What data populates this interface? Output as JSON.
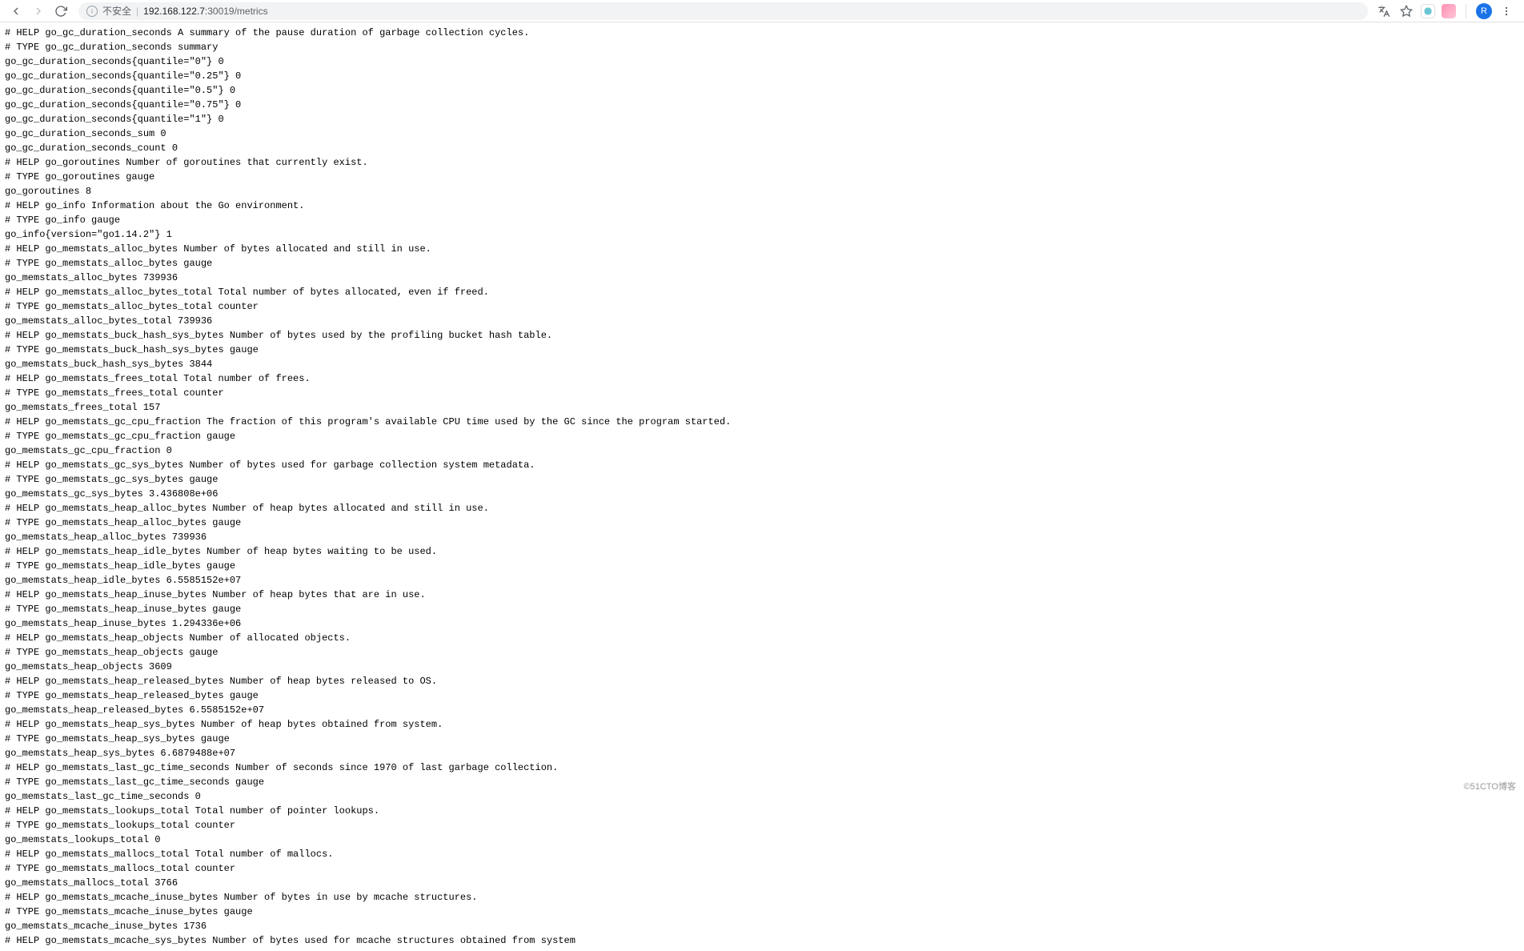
{
  "toolbar": {
    "insecure_label": "不安全",
    "url_host": "192.168.122.7",
    "url_port_path": ":30019/metrics",
    "avatar_initial": "R"
  },
  "metrics_text": "# HELP go_gc_duration_seconds A summary of the pause duration of garbage collection cycles.\n# TYPE go_gc_duration_seconds summary\ngo_gc_duration_seconds{quantile=\"0\"} 0\ngo_gc_duration_seconds{quantile=\"0.25\"} 0\ngo_gc_duration_seconds{quantile=\"0.5\"} 0\ngo_gc_duration_seconds{quantile=\"0.75\"} 0\ngo_gc_duration_seconds{quantile=\"1\"} 0\ngo_gc_duration_seconds_sum 0\ngo_gc_duration_seconds_count 0\n# HELP go_goroutines Number of goroutines that currently exist.\n# TYPE go_goroutines gauge\ngo_goroutines 8\n# HELP go_info Information about the Go environment.\n# TYPE go_info gauge\ngo_info{version=\"go1.14.2\"} 1\n# HELP go_memstats_alloc_bytes Number of bytes allocated and still in use.\n# TYPE go_memstats_alloc_bytes gauge\ngo_memstats_alloc_bytes 739936\n# HELP go_memstats_alloc_bytes_total Total number of bytes allocated, even if freed.\n# TYPE go_memstats_alloc_bytes_total counter\ngo_memstats_alloc_bytes_total 739936\n# HELP go_memstats_buck_hash_sys_bytes Number of bytes used by the profiling bucket hash table.\n# TYPE go_memstats_buck_hash_sys_bytes gauge\ngo_memstats_buck_hash_sys_bytes 3844\n# HELP go_memstats_frees_total Total number of frees.\n# TYPE go_memstats_frees_total counter\ngo_memstats_frees_total 157\n# HELP go_memstats_gc_cpu_fraction The fraction of this program's available CPU time used by the GC since the program started.\n# TYPE go_memstats_gc_cpu_fraction gauge\ngo_memstats_gc_cpu_fraction 0\n# HELP go_memstats_gc_sys_bytes Number of bytes used for garbage collection system metadata.\n# TYPE go_memstats_gc_sys_bytes gauge\ngo_memstats_gc_sys_bytes 3.436808e+06\n# HELP go_memstats_heap_alloc_bytes Number of heap bytes allocated and still in use.\n# TYPE go_memstats_heap_alloc_bytes gauge\ngo_memstats_heap_alloc_bytes 739936\n# HELP go_memstats_heap_idle_bytes Number of heap bytes waiting to be used.\n# TYPE go_memstats_heap_idle_bytes gauge\ngo_memstats_heap_idle_bytes 6.5585152e+07\n# HELP go_memstats_heap_inuse_bytes Number of heap bytes that are in use.\n# TYPE go_memstats_heap_inuse_bytes gauge\ngo_memstats_heap_inuse_bytes 1.294336e+06\n# HELP go_memstats_heap_objects Number of allocated objects.\n# TYPE go_memstats_heap_objects gauge\ngo_memstats_heap_objects 3609\n# HELP go_memstats_heap_released_bytes Number of heap bytes released to OS.\n# TYPE go_memstats_heap_released_bytes gauge\ngo_memstats_heap_released_bytes 6.5585152e+07\n# HELP go_memstats_heap_sys_bytes Number of heap bytes obtained from system.\n# TYPE go_memstats_heap_sys_bytes gauge\ngo_memstats_heap_sys_bytes 6.6879488e+07\n# HELP go_memstats_last_gc_time_seconds Number of seconds since 1970 of last garbage collection.\n# TYPE go_memstats_last_gc_time_seconds gauge\ngo_memstats_last_gc_time_seconds 0\n# HELP go_memstats_lookups_total Total number of pointer lookups.\n# TYPE go_memstats_lookups_total counter\ngo_memstats_lookups_total 0\n# HELP go_memstats_mallocs_total Total number of mallocs.\n# TYPE go_memstats_mallocs_total counter\ngo_memstats_mallocs_total 3766\n# HELP go_memstats_mcache_inuse_bytes Number of bytes in use by mcache structures.\n# TYPE go_memstats_mcache_inuse_bytes gauge\ngo_memstats_mcache_inuse_bytes 1736\n# HELP go_memstats_mcache_sys_bytes Number of bytes used for mcache structures obtained from system",
  "watermark": "©51CTO博客"
}
